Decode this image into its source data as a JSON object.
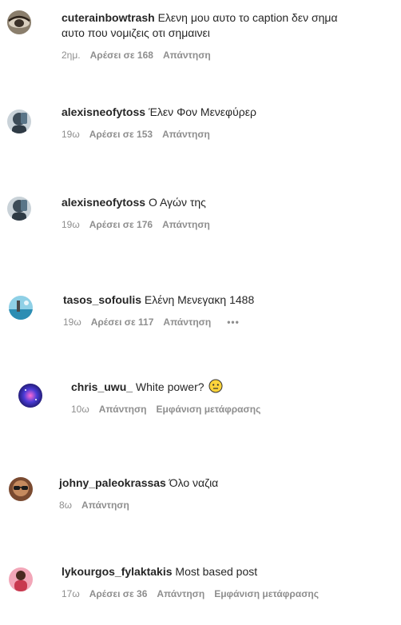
{
  "comments": [
    {
      "username": "cuterainbowtrash",
      "text_line1": "Ελενη μου αυτο το caption δεν σημα",
      "text_line2": "αυτο που νομιζεις οτι σημαινει",
      "time": "2ημ.",
      "likes": "Αρέσει σε 168",
      "reply": "Απάντηση",
      "avatar_icon": "avatar-eye",
      "avatar_color": "#7a6f60"
    },
    {
      "username": "alexisneofytoss",
      "text": "Έλεν Φον Μενεφύρερ",
      "time": "19ω",
      "likes": "Αρέσει σε 153",
      "reply": "Απάντηση",
      "avatar_icon": "avatar-masked-person",
      "avatar_color": "#4a5a66"
    },
    {
      "username": "alexisneofytoss",
      "text": "Ο Αγών της",
      "time": "19ω",
      "likes": "Αρέσει σε 176",
      "reply": "Απάντηση",
      "avatar_icon": "avatar-masked-person",
      "avatar_color": "#4a5a66"
    },
    {
      "username": "tasos_sofoulis",
      "text": "Ελένη Μενεγακη 1488",
      "time": "19ω",
      "likes": "Αρέσει σε 117",
      "reply": "Απάντηση",
      "more": "•••",
      "avatar_icon": "avatar-landscape",
      "avatar_color": "#3fa6c9"
    },
    {
      "username": "chris_uwu_",
      "text": "White power?",
      "time": "10ω",
      "reply": "Απάντηση",
      "translate": "Εμφάνιση μετάφρασης",
      "emoji_icon": "neutral-face-emoji-icon",
      "avatar_icon": "avatar-galaxy",
      "avatar_color": "#3a36a8"
    },
    {
      "username": "johny_paleokrassas",
      "text": "Όλο ναζια",
      "time": "8ω",
      "reply": "Απάντηση",
      "avatar_icon": "avatar-sunglasses",
      "avatar_color": "#6b3a22"
    },
    {
      "username": "lykourgos_fylaktakis",
      "text": "Most based post",
      "time": "17ω",
      "likes": "Αρέσει σε 36",
      "reply": "Απάντηση",
      "translate": "Εμφάνιση μετάφρασης",
      "avatar_icon": "avatar-person-red",
      "avatar_color": "#c8394f"
    }
  ]
}
